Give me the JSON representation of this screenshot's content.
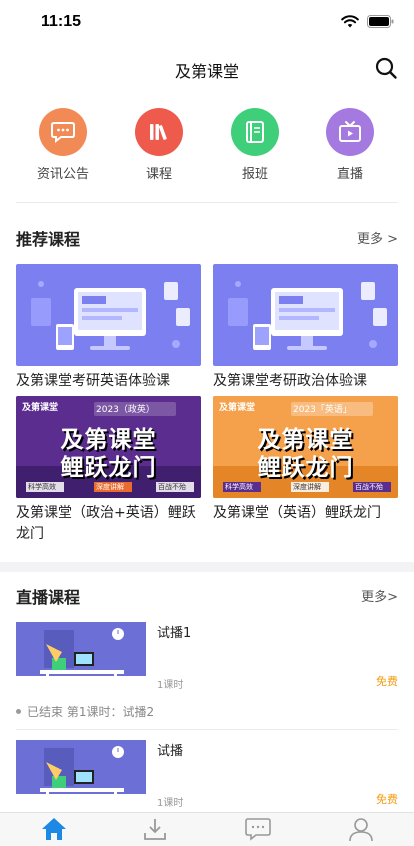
{
  "status": {
    "time": "11:15"
  },
  "nav": {
    "title": "及第课堂"
  },
  "quick_menu": [
    {
      "label": "资讯公告",
      "color": "#f28a55",
      "icon": "chat-bubble-icon"
    },
    {
      "label": "课程",
      "color": "#ee5a4c",
      "icon": "books-icon"
    },
    {
      "label": "报班",
      "color": "#3fcf7b",
      "icon": "book-icon"
    },
    {
      "label": "直播",
      "color": "#a57ae0",
      "icon": "tv-icon"
    }
  ],
  "recommended": {
    "title": "推荐课程",
    "more": "更多 >",
    "courses": [
      {
        "title": "及第课堂考研英语体验课"
      },
      {
        "title": "及第课堂考研政治体验课"
      },
      {
        "title": "及第课堂（政治+英语）鲤跃龙门",
        "banner_year": "2023（政英）"
      },
      {
        "title": "及第课堂（英语）鲤跃龙门",
        "banner_year": "2023「英语」"
      }
    ],
    "banner_text": {
      "brand": "及第课堂",
      "line1": "及第课堂",
      "line2": "鲤跃龙门",
      "tag1": "科学高效",
      "tag2": "深度讲解",
      "tag3": "百战不殆"
    }
  },
  "live": {
    "title": "直播课程",
    "more": "更多>",
    "items": [
      {
        "title": "试播1",
        "hours": "1课时",
        "price": "免费",
        "status": "已结束  第1课时：试播2"
      },
      {
        "title": "试播",
        "hours": "1课时",
        "price": "免费"
      }
    ]
  },
  "colors": {
    "accent": "#1e88e5",
    "price": "#f39c12",
    "banner_purple": "#5b2d8e",
    "banner_orange": "#f5a04a",
    "cover_blue": "#7b7ff0"
  },
  "tab_bar": [
    {
      "name": "tab-home",
      "icon": "home-icon"
    },
    {
      "name": "tab-download",
      "icon": "download-icon"
    },
    {
      "name": "tab-messages",
      "icon": "message-icon"
    },
    {
      "name": "tab-profile",
      "icon": "profile-icon"
    }
  ]
}
